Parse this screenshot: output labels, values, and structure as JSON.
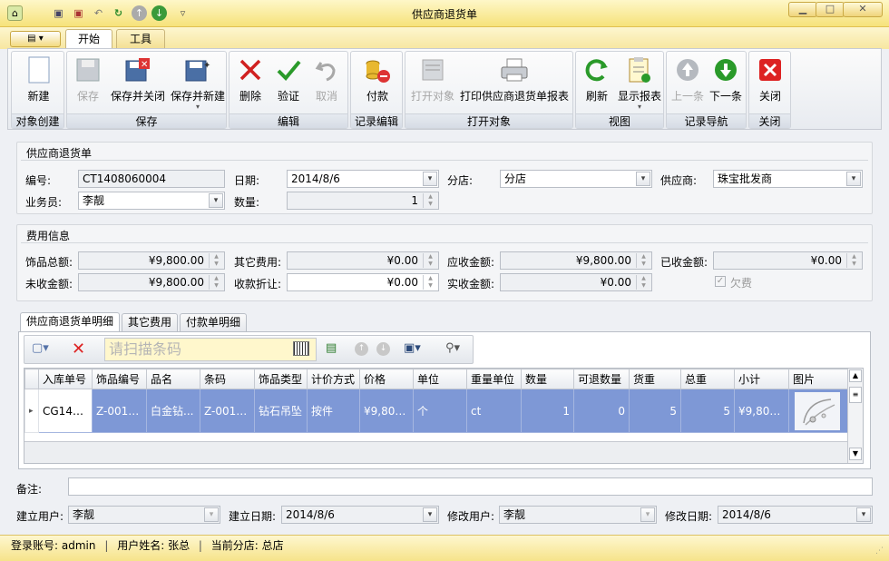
{
  "window": {
    "title": "供应商退货单"
  },
  "ribbon_tabs": [
    {
      "label": "开始"
    },
    {
      "label": "工具"
    }
  ],
  "groups": {
    "create": {
      "label": "对象创建",
      "new": "新建"
    },
    "save": {
      "label": "保存",
      "save": "保存",
      "save_close": "保存并关闭",
      "save_new": "保存并新建"
    },
    "edit": {
      "label": "编辑",
      "delete": "删除",
      "verify": "验证",
      "cancel": "取消"
    },
    "record_edit": {
      "label": "记录编辑",
      "pay": "付款"
    },
    "open": {
      "label": "打开对象",
      "open_object": "打开对象",
      "print_report": "打印供应商退货单报表"
    },
    "view": {
      "label": "视图",
      "refresh": "刷新",
      "show_report": "显示报表"
    },
    "nav": {
      "label": "记录导航",
      "prev": "上一条",
      "next": "下一条"
    },
    "close": {
      "label": "关闭",
      "close": "关闭"
    }
  },
  "header": {
    "title": "供应商退货单",
    "code_label": "编号:",
    "code": "CT1408060004",
    "date_label": "日期:",
    "date": "2014/8/6",
    "branch_label": "分店:",
    "branch": "分店",
    "supplier_label": "供应商:",
    "supplier": "珠宝批发商",
    "salesman_label": "业务员:",
    "salesman": "李靓",
    "qty_label": "数量:",
    "qty": "1"
  },
  "fees": {
    "title": "费用信息",
    "jewelry_total_label": "饰品总额:",
    "jewelry_total": "¥9,800.00",
    "other_fee_label": "其它费用:",
    "other_fee": "¥0.00",
    "receivable_label": "应收金额:",
    "receivable": "¥9,800.00",
    "received_label": "已收金额:",
    "received": "¥0.00",
    "unreceived_label": "未收金额:",
    "unreceived": "¥9,800.00",
    "discount_label": "收款折让:",
    "discount": "¥0.00",
    "actual_label": "实收金额:",
    "actual": "¥0.00",
    "owe_label": "欠费",
    "owe_checked": true
  },
  "detail_tabs": [
    {
      "label": "供应商退货单明细"
    },
    {
      "label": "其它费用"
    },
    {
      "label": "付款单明细"
    }
  ],
  "grid_toolbar": {
    "barcode_placeholder": "请扫描条码"
  },
  "grid": {
    "columns": [
      "入库单号",
      "饰品编号",
      "品名",
      "条码",
      "饰品类型",
      "计价方式",
      "价格",
      "单位",
      "重量单位",
      "数量",
      "可退数量",
      "货重",
      "总重",
      "小计",
      "图片"
    ],
    "rows": [
      [
        "CG140...",
        "Z-0012...",
        "白金钻...",
        "Z-0012...",
        "钻石吊坠",
        "按件",
        "¥9,800....",
        "个",
        "ct",
        "1",
        "0",
        "5",
        "5",
        "¥9,800...."
      ]
    ]
  },
  "remark": {
    "label": "备注:",
    "value": ""
  },
  "footer": {
    "created_user_label": "建立用户:",
    "created_user": "李靓",
    "created_date_label": "建立日期:",
    "created_date": "2014/8/6",
    "modified_user_label": "修改用户:",
    "modified_user": "李靓",
    "modified_date_label": "修改日期:",
    "modified_date": "2014/8/6"
  },
  "status": {
    "account_label": "登录账号:",
    "account": "admin",
    "username_label": "用户姓名:",
    "username": "张总",
    "branch_label": "当前分店:",
    "branch": "总店"
  },
  "colors": {
    "title_bar": "#f6e27a",
    "selection": "#7e98d6",
    "barcode_bg": "#fff7cc"
  }
}
